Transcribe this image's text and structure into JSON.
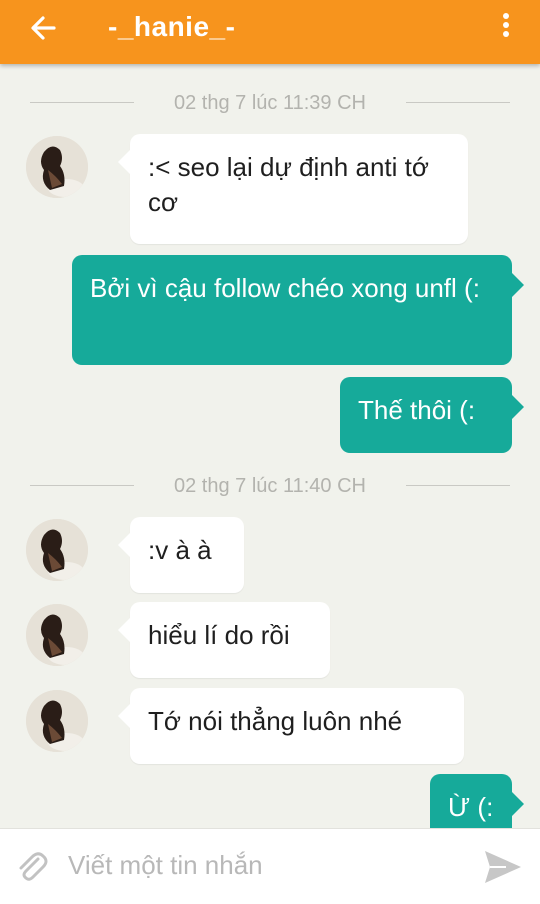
{
  "header": {
    "title": "-_hanie_-",
    "back_icon": "arrow-left-icon",
    "menu_icon": "more-vertical-icon",
    "bar_color": "#f7941d"
  },
  "chat": {
    "dividers": [
      {
        "label": "02 thg 7 lúc 11:39 CH"
      },
      {
        "label": "02 thg 7 lúc 11:40 CH"
      }
    ],
    "messages": [
      {
        "direction": "incoming",
        "text": ":< seo lại dự định anti tớ cơ"
      },
      {
        "direction": "outgoing",
        "text": "Bởi vì cậu follow chéo xong unfl (:"
      },
      {
        "direction": "outgoing",
        "text": "Thế thôi (:"
      },
      {
        "direction": "incoming",
        "text": ":v à à"
      },
      {
        "direction": "incoming",
        "text": "hiểu lí do rồi"
      },
      {
        "direction": "incoming",
        "text": "Tớ nói thẳng luôn nhé"
      },
      {
        "direction": "outgoing",
        "text": "Ừ (:"
      }
    ],
    "outgoing_color": "#16aa9a",
    "incoming_color": "#ffffff"
  },
  "composer": {
    "placeholder": "Viết một tin nhắn",
    "attach_icon": "paperclip-icon",
    "send_icon": "send-icon"
  }
}
